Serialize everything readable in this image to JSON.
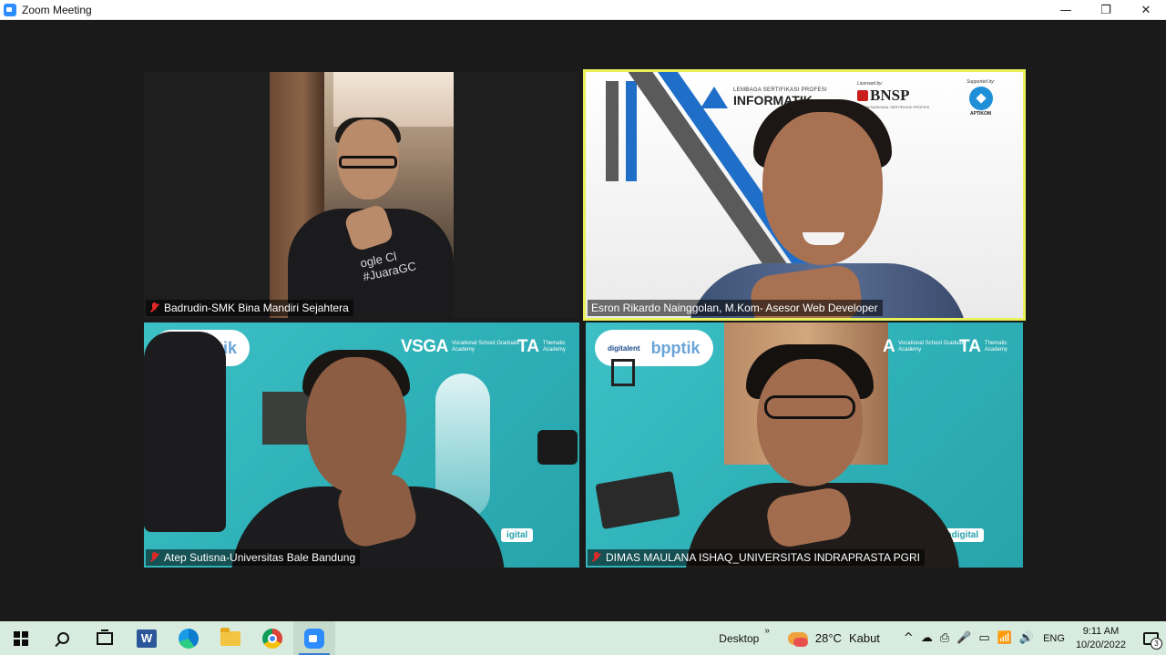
{
  "window": {
    "title": "Zoom Meeting",
    "controls": {
      "minimize": "—",
      "restore": "❐",
      "close": "✕"
    }
  },
  "participants": [
    {
      "name": "Badrudin-SMK Bina Mandiri Sejahtera",
      "muted": true,
      "shirt_text": "ogle Cl #JuaraGC"
    },
    {
      "name": "Esron Rikardo Nainggolan, M.Kom- Asesor Web Developer",
      "muted": false,
      "active_speaker": true,
      "background": {
        "lsp_small": "LEMBAGA SERTIFIKASI PROFESI",
        "lsp_big": "INFORMATIK",
        "bnsp_small": "Licensed by:",
        "bnsp_big": "BNSP",
        "bnsp_tiny": "BADAN NASIONAL SERTIFIKASI PROFESI",
        "aptikom_small": "Supported by:",
        "aptikom_tiny": "APTIKOM"
      }
    },
    {
      "name": "Atep Sutisna-Universitas Bale Bandung",
      "muted": true,
      "background": {
        "pill_left": "ent",
        "pill_right": "bpptik",
        "vsga": "VSGA",
        "vsga_sub": "Vocational School Graduate Academy",
        "ta": "TA",
        "ta_sub": "Thematic Academy",
        "tag": "igital"
      }
    },
    {
      "name": "DIMAS MAULANA ISHAQ_UNIVERSITAS INDRAPRASTA PGRI",
      "muted": true,
      "background": {
        "pill_left": "digitalent",
        "pill_right": "bpptik",
        "vsga": "A",
        "vsga_sub": "Vocational School Graduate Academy",
        "ta": "TA",
        "ta_sub": "Thematic Academy",
        "tag": "andigital"
      }
    }
  ],
  "taskbar": {
    "desktop_label": "Desktop",
    "desktop_chevron": "»",
    "weather": {
      "temp": "28°C",
      "condition": "Kabut"
    },
    "tray_icons": [
      "^",
      "☁",
      "⎙",
      "🎤",
      "▭",
      "📶",
      "🔊"
    ],
    "language": "ENG",
    "time": "9:11 AM",
    "date": "10/20/2022",
    "notification_count": "3",
    "word_letter": "W"
  }
}
